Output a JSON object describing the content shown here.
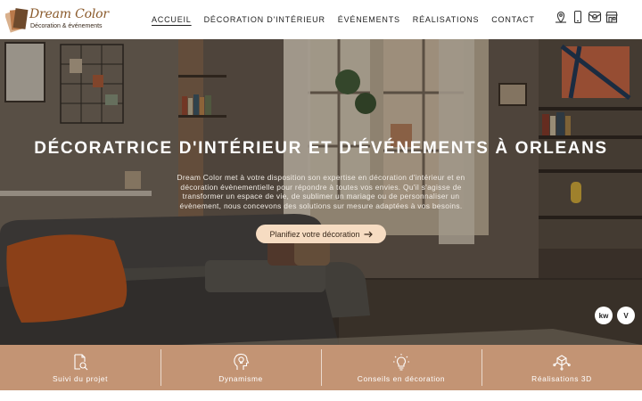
{
  "brand": {
    "name": "Dream Color",
    "tagline": "Décoration & événements"
  },
  "nav": {
    "items": [
      {
        "label": "ACCUEIL",
        "active": true
      },
      {
        "label": "DÉCORATION D'INTÉRIEUR"
      },
      {
        "label": "ÉVÉNEMENTS"
      },
      {
        "label": "RÉALISATIONS"
      },
      {
        "label": "CONTACT"
      }
    ]
  },
  "header_icons": [
    "location-pin-icon",
    "phone-icon",
    "instagram-icon",
    "shop-icon"
  ],
  "hero": {
    "title": "DÉCORATRICE D'INTÉRIEUR ET D'ÉVÉNEMENTS À ORLEANS",
    "text": "Dream Color met à votre disposition son expertise en décoration d'intérieur et en décoration évènementielle pour répondre à toutes vos envies. Qu'il s'agisse de transformer un espace de vie, de sublimer un mariage ou de personnaliser un évènement, nous concevons des solutions sur mesure adaptées à vos besoins.",
    "cta": "Planifiez votre décoration",
    "cta_icon": "arrow-right-icon",
    "badges": [
      "kw",
      "V"
    ]
  },
  "features": [
    {
      "label": "Suivi du projet",
      "icon": "document-search-icon"
    },
    {
      "label": "Dynamisme",
      "icon": "head-lightbulb-icon"
    },
    {
      "label": "Conseils en décoration",
      "icon": "lightbulb-icon"
    },
    {
      "label": "Réalisations 3D",
      "icon": "cube-network-icon"
    }
  ],
  "colors": {
    "accent": "#c39474",
    "cta_bg": "#f6dcc2",
    "brand_text": "#8a5a2b"
  }
}
